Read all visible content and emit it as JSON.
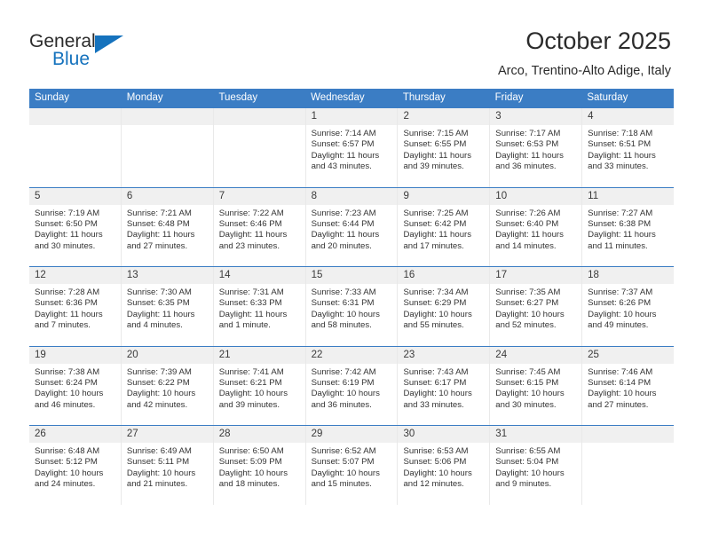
{
  "logo": {
    "word1": "General",
    "word2": "Blue",
    "triangle_icon": "triangle-icon",
    "accent_color": "#1572bd"
  },
  "header": {
    "title": "October 2025",
    "location": "Arco, Trentino-Alto Adige, Italy"
  },
  "theme": {
    "header_bar_color": "#3b7dc4",
    "day_number_band_color": "#f0f0f0",
    "text_color": "#333333"
  },
  "day_names": [
    "Sunday",
    "Monday",
    "Tuesday",
    "Wednesday",
    "Thursday",
    "Friday",
    "Saturday"
  ],
  "labels": {
    "sunrise": "Sunrise:",
    "sunset": "Sunset:",
    "daylight": "Daylight:"
  },
  "weeks": [
    [
      {
        "day": "",
        "empty": true
      },
      {
        "day": "",
        "empty": true
      },
      {
        "day": "",
        "empty": true
      },
      {
        "day": "1",
        "sunrise": "Sunrise: 7:14 AM",
        "sunset": "Sunset: 6:57 PM",
        "daylight1": "Daylight: 11 hours",
        "daylight2": "and 43 minutes."
      },
      {
        "day": "2",
        "sunrise": "Sunrise: 7:15 AM",
        "sunset": "Sunset: 6:55 PM",
        "daylight1": "Daylight: 11 hours",
        "daylight2": "and 39 minutes."
      },
      {
        "day": "3",
        "sunrise": "Sunrise: 7:17 AM",
        "sunset": "Sunset: 6:53 PM",
        "daylight1": "Daylight: 11 hours",
        "daylight2": "and 36 minutes."
      },
      {
        "day": "4",
        "sunrise": "Sunrise: 7:18 AM",
        "sunset": "Sunset: 6:51 PM",
        "daylight1": "Daylight: 11 hours",
        "daylight2": "and 33 minutes."
      }
    ],
    [
      {
        "day": "5",
        "sunrise": "Sunrise: 7:19 AM",
        "sunset": "Sunset: 6:50 PM",
        "daylight1": "Daylight: 11 hours",
        "daylight2": "and 30 minutes."
      },
      {
        "day": "6",
        "sunrise": "Sunrise: 7:21 AM",
        "sunset": "Sunset: 6:48 PM",
        "daylight1": "Daylight: 11 hours",
        "daylight2": "and 27 minutes."
      },
      {
        "day": "7",
        "sunrise": "Sunrise: 7:22 AM",
        "sunset": "Sunset: 6:46 PM",
        "daylight1": "Daylight: 11 hours",
        "daylight2": "and 23 minutes."
      },
      {
        "day": "8",
        "sunrise": "Sunrise: 7:23 AM",
        "sunset": "Sunset: 6:44 PM",
        "daylight1": "Daylight: 11 hours",
        "daylight2": "and 20 minutes."
      },
      {
        "day": "9",
        "sunrise": "Sunrise: 7:25 AM",
        "sunset": "Sunset: 6:42 PM",
        "daylight1": "Daylight: 11 hours",
        "daylight2": "and 17 minutes."
      },
      {
        "day": "10",
        "sunrise": "Sunrise: 7:26 AM",
        "sunset": "Sunset: 6:40 PM",
        "daylight1": "Daylight: 11 hours",
        "daylight2": "and 14 minutes."
      },
      {
        "day": "11",
        "sunrise": "Sunrise: 7:27 AM",
        "sunset": "Sunset: 6:38 PM",
        "daylight1": "Daylight: 11 hours",
        "daylight2": "and 11 minutes."
      }
    ],
    [
      {
        "day": "12",
        "sunrise": "Sunrise: 7:28 AM",
        "sunset": "Sunset: 6:36 PM",
        "daylight1": "Daylight: 11 hours",
        "daylight2": "and 7 minutes."
      },
      {
        "day": "13",
        "sunrise": "Sunrise: 7:30 AM",
        "sunset": "Sunset: 6:35 PM",
        "daylight1": "Daylight: 11 hours",
        "daylight2": "and 4 minutes."
      },
      {
        "day": "14",
        "sunrise": "Sunrise: 7:31 AM",
        "sunset": "Sunset: 6:33 PM",
        "daylight1": "Daylight: 11 hours",
        "daylight2": "and 1 minute."
      },
      {
        "day": "15",
        "sunrise": "Sunrise: 7:33 AM",
        "sunset": "Sunset: 6:31 PM",
        "daylight1": "Daylight: 10 hours",
        "daylight2": "and 58 minutes."
      },
      {
        "day": "16",
        "sunrise": "Sunrise: 7:34 AM",
        "sunset": "Sunset: 6:29 PM",
        "daylight1": "Daylight: 10 hours",
        "daylight2": "and 55 minutes."
      },
      {
        "day": "17",
        "sunrise": "Sunrise: 7:35 AM",
        "sunset": "Sunset: 6:27 PM",
        "daylight1": "Daylight: 10 hours",
        "daylight2": "and 52 minutes."
      },
      {
        "day": "18",
        "sunrise": "Sunrise: 7:37 AM",
        "sunset": "Sunset: 6:26 PM",
        "daylight1": "Daylight: 10 hours",
        "daylight2": "and 49 minutes."
      }
    ],
    [
      {
        "day": "19",
        "sunrise": "Sunrise: 7:38 AM",
        "sunset": "Sunset: 6:24 PM",
        "daylight1": "Daylight: 10 hours",
        "daylight2": "and 46 minutes."
      },
      {
        "day": "20",
        "sunrise": "Sunrise: 7:39 AM",
        "sunset": "Sunset: 6:22 PM",
        "daylight1": "Daylight: 10 hours",
        "daylight2": "and 42 minutes."
      },
      {
        "day": "21",
        "sunrise": "Sunrise: 7:41 AM",
        "sunset": "Sunset: 6:21 PM",
        "daylight1": "Daylight: 10 hours",
        "daylight2": "and 39 minutes."
      },
      {
        "day": "22",
        "sunrise": "Sunrise: 7:42 AM",
        "sunset": "Sunset: 6:19 PM",
        "daylight1": "Daylight: 10 hours",
        "daylight2": "and 36 minutes."
      },
      {
        "day": "23",
        "sunrise": "Sunrise: 7:43 AM",
        "sunset": "Sunset: 6:17 PM",
        "daylight1": "Daylight: 10 hours",
        "daylight2": "and 33 minutes."
      },
      {
        "day": "24",
        "sunrise": "Sunrise: 7:45 AM",
        "sunset": "Sunset: 6:15 PM",
        "daylight1": "Daylight: 10 hours",
        "daylight2": "and 30 minutes."
      },
      {
        "day": "25",
        "sunrise": "Sunrise: 7:46 AM",
        "sunset": "Sunset: 6:14 PM",
        "daylight1": "Daylight: 10 hours",
        "daylight2": "and 27 minutes."
      }
    ],
    [
      {
        "day": "26",
        "sunrise": "Sunrise: 6:48 AM",
        "sunset": "Sunset: 5:12 PM",
        "daylight1": "Daylight: 10 hours",
        "daylight2": "and 24 minutes."
      },
      {
        "day": "27",
        "sunrise": "Sunrise: 6:49 AM",
        "sunset": "Sunset: 5:11 PM",
        "daylight1": "Daylight: 10 hours",
        "daylight2": "and 21 minutes."
      },
      {
        "day": "28",
        "sunrise": "Sunrise: 6:50 AM",
        "sunset": "Sunset: 5:09 PM",
        "daylight1": "Daylight: 10 hours",
        "daylight2": "and 18 minutes."
      },
      {
        "day": "29",
        "sunrise": "Sunrise: 6:52 AM",
        "sunset": "Sunset: 5:07 PM",
        "daylight1": "Daylight: 10 hours",
        "daylight2": "and 15 minutes."
      },
      {
        "day": "30",
        "sunrise": "Sunrise: 6:53 AM",
        "sunset": "Sunset: 5:06 PM",
        "daylight1": "Daylight: 10 hours",
        "daylight2": "and 12 minutes."
      },
      {
        "day": "31",
        "sunrise": "Sunrise: 6:55 AM",
        "sunset": "Sunset: 5:04 PM",
        "daylight1": "Daylight: 10 hours",
        "daylight2": "and 9 minutes."
      },
      {
        "day": "",
        "empty": true
      }
    ]
  ]
}
